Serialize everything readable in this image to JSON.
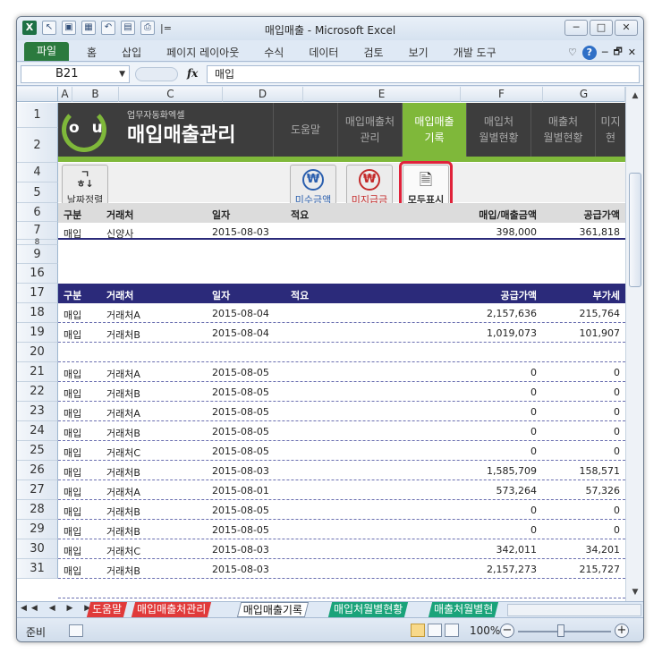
{
  "window": {
    "title": "매입매출 - Microsoft Excel",
    "qa_undo": "↶",
    "qa_sep": "|=",
    "win_min": "─",
    "win_max": "□",
    "win_close": "✕"
  },
  "ribbon": {
    "file": "파일",
    "tabs": [
      "홈",
      "삽입",
      "페이지 레이아웃",
      "수식",
      "데이터",
      "검토",
      "보기",
      "개발 도구"
    ],
    "right_icons": [
      "♡",
      "?",
      "─",
      "🗗",
      "✕"
    ]
  },
  "formula_bar": {
    "cell_ref": "B21",
    "fx": "fx",
    "content": "매입"
  },
  "columns": [
    "A",
    "B",
    "C",
    "D",
    "E",
    "F",
    "G"
  ],
  "rows": [
    "1",
    "2",
    "4",
    "5",
    "6",
    "7",
    "8",
    "9",
    "16",
    "17",
    "18",
    "19",
    "20",
    "21",
    "22",
    "23",
    "24",
    "25",
    "26",
    "27",
    "28",
    "29",
    "30",
    "31"
  ],
  "banner": {
    "logo_text": "o u",
    "subtitle": "업무자동화엑셀",
    "title": "매입매출관리",
    "nav": [
      {
        "label": "도움말"
      },
      {
        "label": "매입매출처\n관리"
      },
      {
        "label": "매입매출\n기록"
      },
      {
        "label": "매입처\n월별현황"
      },
      {
        "label": "매출처\n월별현황"
      },
      {
        "label": "미지\n현"
      }
    ]
  },
  "toolbar": {
    "sort_icon": "ㄱ\nㅎ↓",
    "sort_label": "날짜정렬",
    "unpaid_icon": "₩",
    "unpaid_label": "미수금액",
    "unpaid2_icon": "₩",
    "unpaid2_label": "미지급금",
    "showall_icon": "🗎",
    "showall_label": "모두표시"
  },
  "summary_header": [
    "구분",
    "거래처",
    "일자",
    "적요",
    "매입/매출금액",
    "공급가액"
  ],
  "summary_row": [
    "매입",
    "신양사",
    "2015-08-03",
    "",
    "398,000",
    "361,818"
  ],
  "table_header": [
    "구분",
    "거래처",
    "일자",
    "적요",
    "공급가액",
    "부가세"
  ],
  "table_rows": [
    [
      "매입",
      "거래처A",
      "2015-08-04",
      "",
      "2,157,636",
      "215,764"
    ],
    [
      "매입",
      "거래처B",
      "2015-08-04",
      "",
      "1,019,073",
      "101,907"
    ],
    [
      "",
      "",
      "",
      "",
      "",
      ""
    ],
    [
      "매입",
      "거래처A",
      "2015-08-05",
      "",
      "0",
      "0"
    ],
    [
      "매입",
      "거래처B",
      "2015-08-05",
      "",
      "0",
      "0"
    ],
    [
      "매입",
      "거래처A",
      "2015-08-05",
      "",
      "0",
      "0"
    ],
    [
      "매입",
      "거래처B",
      "2015-08-05",
      "",
      "0",
      "0"
    ],
    [
      "매입",
      "거래처C",
      "2015-08-05",
      "",
      "0",
      "0"
    ],
    [
      "매입",
      "거래처B",
      "2015-08-03",
      "",
      "1,585,709",
      "158,571"
    ],
    [
      "매입",
      "거래처A",
      "2015-08-01",
      "",
      "573,264",
      "57,326"
    ],
    [
      "매입",
      "거래처B",
      "2015-08-05",
      "",
      "0",
      "0"
    ],
    [
      "매입",
      "거래처B",
      "2015-08-05",
      "",
      "0",
      "0"
    ],
    [
      "매입",
      "거래처C",
      "2015-08-03",
      "",
      "342,011",
      "34,201"
    ],
    [
      "매입",
      "거래처B",
      "2015-08-03",
      "",
      "2,157,273",
      "215,727"
    ],
    [
      "",
      "",
      "",
      "",
      "",
      ""
    ],
    [
      "",
      "",
      "",
      "",
      "",
      ""
    ]
  ],
  "sheets": {
    "nav": "◀◀ ◀ ▶ ▶▶",
    "tabs": [
      {
        "label": "도움말",
        "color": "#e03a3a"
      },
      {
        "label": "매입매출처관리",
        "color": "#e03a3a"
      },
      {
        "label": "매입매출기록",
        "color": "#ffffff"
      },
      {
        "label": "매입처월별현황",
        "color": "#1aa37a"
      },
      {
        "label": "매출처월별현",
        "color": "#1aa37a"
      }
    ]
  },
  "status": {
    "ready": "준비",
    "zoom": "100%",
    "zoom_minus": "−",
    "zoom_plus": "+"
  },
  "colors": {
    "banner_bg": "#3d3d3d",
    "accent_green": "#7fb83a",
    "header_navy": "#2b2a7a",
    "highlight_red": "#e0223a"
  }
}
